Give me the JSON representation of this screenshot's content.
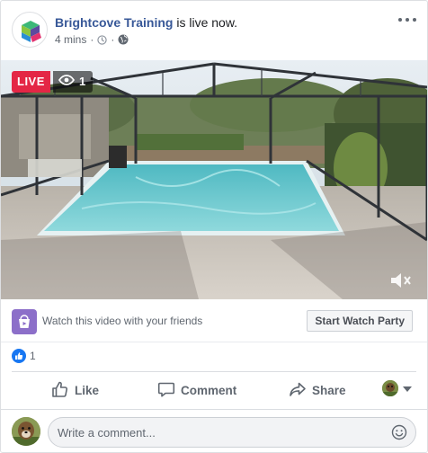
{
  "header": {
    "page_name": "Brightcove Training",
    "status_text": " is live now.",
    "time_ago": "4 mins",
    "separator": "·",
    "icons": [
      "clock-icon",
      "globe-icon",
      "more-icon"
    ]
  },
  "video": {
    "live_label": "LIVE",
    "viewer_count": "1",
    "icons": [
      "eye-icon",
      "mute-icon"
    ]
  },
  "watch_party": {
    "prompt": "Watch this video with your friends",
    "button_label": "Start Watch Party"
  },
  "reactions": {
    "count": "1"
  },
  "actions": {
    "like": "Like",
    "comment": "Comment",
    "share": "Share"
  },
  "composer": {
    "placeholder": "Write a comment..."
  },
  "colors": {
    "accent": "#385898",
    "live": "#e42645",
    "like_blue": "#1877f2",
    "party_purple": "#8c6fc9"
  }
}
